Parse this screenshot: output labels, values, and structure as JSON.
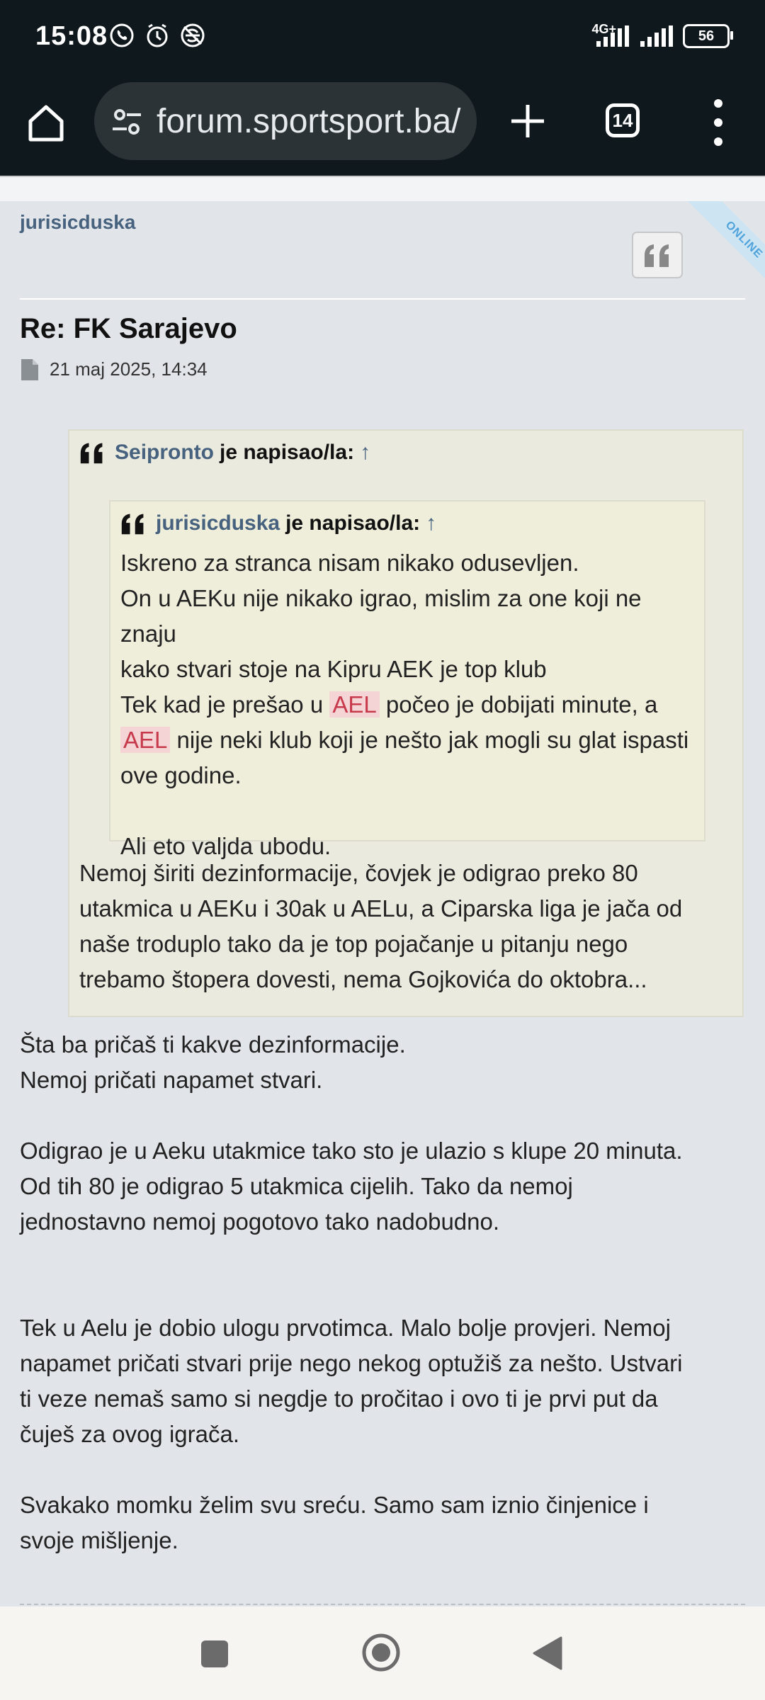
{
  "status_bar": {
    "time": "15:08",
    "network": "4G+",
    "battery": "56"
  },
  "browser": {
    "url": "forum.sportsport.ba/",
    "tab_count": "14"
  },
  "post": {
    "author": "jurisicduska",
    "online_label": "ONLINE",
    "title": "Re: FK Sarajevo",
    "date": "21 maj 2025, 14:34",
    "outer_quote": {
      "name": "Seipronto",
      "wrote": "je napisao/la:",
      "arrow": "↑",
      "inner_quote": {
        "name": "jurisicduska",
        "wrote": "je napisao/la:",
        "arrow": "↑",
        "line1": "Iskreno za stranca nisam nikako odusevljen.",
        "line2": "On u AEKu nije nikako igrao, mislim za one koji ne znaju",
        "line3": "kako stvari stoje na Kipru AEK je top klub",
        "line4_a": "Tek kad je prešao u ",
        "highlight1": "AEL",
        "line4_b": " počeo je dobijati minute, a",
        "highlight2": "AEL",
        "line5_b": " nije neki klub koji je nešto jak mogli su glat ispasti",
        "line6": "ove godine.",
        "line7": "Ali eto valjda ubodu."
      },
      "reply_line1": "Nemoj širiti dezinformacije, čovjek je odigrao preko 80",
      "reply_line2": "utakmica u AEKu i 30ak u AELu, a Ciparska liga je jača od",
      "reply_line3": "naše troduplo tako da je top pojačanje u pitanju nego",
      "reply_line4": "trebamo štopera dovesti, nema Gojkovića do oktobra..."
    },
    "body": {
      "p1_line1": "Šta ba pričaš ti kakve dezinformacije.",
      "p1_line2": "Nemoj pričati napamet stvari.",
      "p2_line1": "Odigrao je u Aeku utakmice tako sto je ulazio s klupe 20 minuta.",
      "p2_line2": "Od tih 80 je odigrao 5 utakmica cijelih. Tako da nemoj",
      "p2_line3": "jednostavno nemoj pogotovo tako nadobudno.",
      "p3_line1": "Tek u Aelu je dobio ulogu prvotimca. Malo bolje provjeri. Nemoj",
      "p3_line2": "napamet pričati stvari prije nego nekog optužiš za nešto. Ustvari",
      "p3_line3": "ti veze nemaš samo si negdje to pročitao i ovo ti je prvi put da",
      "p3_line4": "čuješ za ovog igrača.",
      "p4_line1": "Svakako momku želim svu sreću. Samo sam iznio činjenice i",
      "p4_line2": "svoje mišljenje."
    }
  }
}
